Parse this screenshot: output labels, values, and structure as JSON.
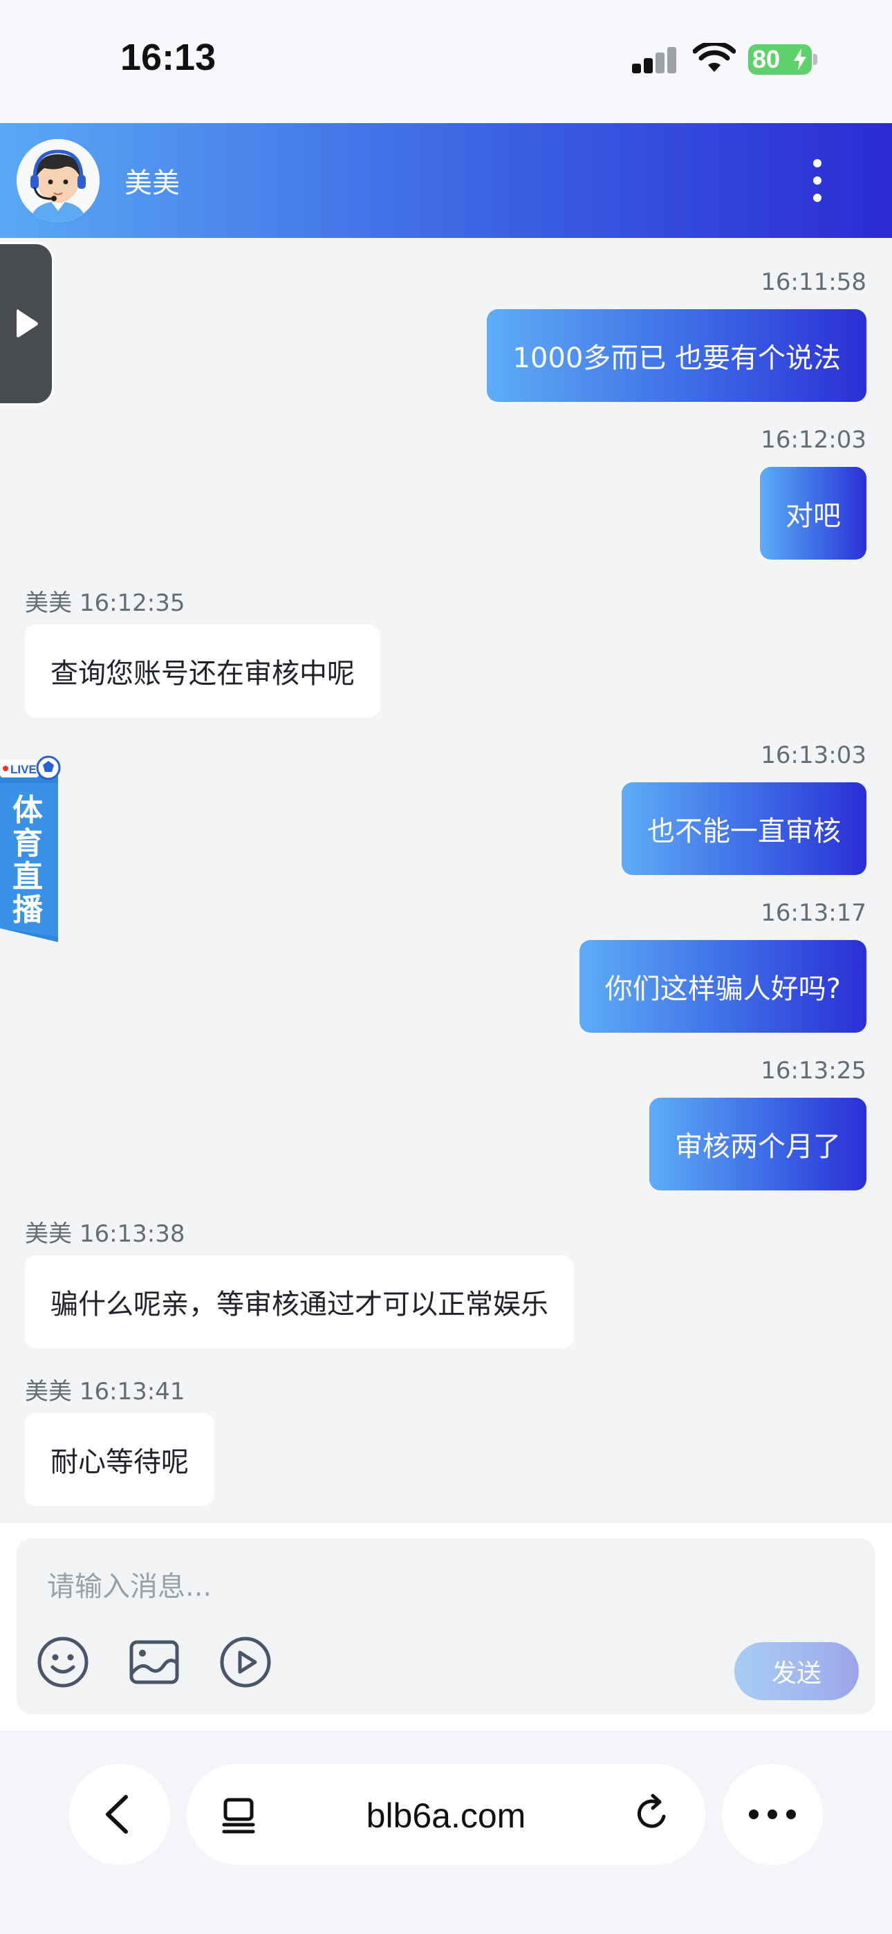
{
  "status_bar": {
    "time": "16:13",
    "battery": "80"
  },
  "header": {
    "agent_name": "美美",
    "avatar_icon": "agent-avatar-headset",
    "more_icon": "more-vertical-icon"
  },
  "side_widgets": {
    "toggle_icon": "play-arrow-icon",
    "sports_badge": {
      "live": "LIVE",
      "text": [
        "体",
        "育",
        "直",
        "播"
      ]
    }
  },
  "messages": [
    {
      "from": "me",
      "time": "16:11:58",
      "text": "1000多而已  也要有个说法"
    },
    {
      "from": "me",
      "time": "16:12:03",
      "text": "对吧"
    },
    {
      "from": "agent",
      "sender": "美美",
      "time": "16:12:35",
      "text": "查询您账号还在审核中呢"
    },
    {
      "from": "me",
      "time": "16:13:03",
      "text": "也不能一直审核"
    },
    {
      "from": "me",
      "time": "16:13:17",
      "text": "你们这样骗人好吗?"
    },
    {
      "from": "me",
      "time": "16:13:25",
      "text": "审核两个月了"
    },
    {
      "from": "agent",
      "sender": "美美",
      "time": "16:13:38",
      "text": "骗什么呢亲，等审核通过才可以正常娱乐"
    },
    {
      "from": "agent",
      "sender": "美美",
      "time": "16:13:41",
      "text": "耐心等待呢"
    }
  ],
  "composer": {
    "placeholder": "请输入消息...",
    "send_label": "发送",
    "tools": [
      "emoji-icon",
      "image-icon",
      "video-icon"
    ]
  },
  "browser": {
    "url": "blb6a.com"
  },
  "colors": {
    "header_gradient_start": "#5aa8f5",
    "header_gradient_end": "#2b2bd4",
    "outgoing_bubble_start": "#5eadf6",
    "outgoing_bubble_end": "#2a2fd6",
    "battery_green": "#5fd16b"
  }
}
